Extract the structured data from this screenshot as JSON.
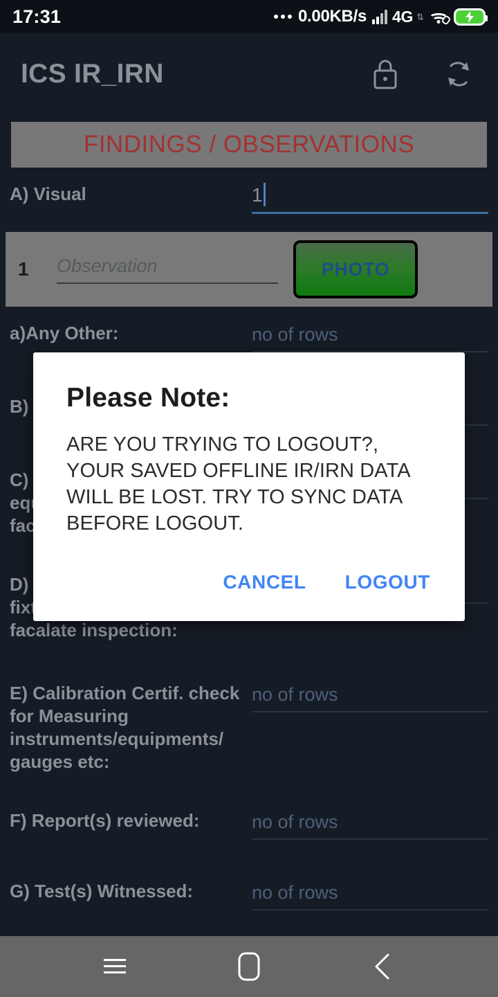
{
  "status_bar": {
    "time": "17:31",
    "net_speed": "0.00KB/s",
    "network_type": "4G",
    "icons": [
      "more-dots-icon",
      "signal-bars-icon",
      "wifi-icon",
      "battery-charging-icon"
    ]
  },
  "app_bar": {
    "title": "ICS IR_IRN",
    "lock_icon": "lock-icon",
    "sync_icon": "sync-icon"
  },
  "page": {
    "banner": "FINDINGS / OBSERVATIONS",
    "sections": [
      {
        "label": "A) Visual",
        "value": "1",
        "placeholder": "no of rows",
        "focused": true
      },
      {
        "label": "a)Any Other:",
        "value": "",
        "placeholder": "no of rows",
        "focused": false
      },
      {
        "label": "B)",
        "value": "",
        "placeholder": "no of rows",
        "focused": false
      },
      {
        "label": "C)\nequ\nfac",
        "value": "",
        "placeholder": "no of rows",
        "focused": false
      },
      {
        "label": "D)\nfixture/clamp used to\nfacalate inspection:",
        "value": "",
        "placeholder": "no of rows",
        "focused": false
      },
      {
        "label": "E) Calibration Certif. check for Measuring instruments/equipments/ gauges etc:",
        "value": "",
        "placeholder": "no of rows",
        "focused": false
      },
      {
        "label": "F) Report(s) reviewed:",
        "value": "",
        "placeholder": "no of rows",
        "focused": false
      },
      {
        "label": "G) Test(s) Witnessed:",
        "value": "",
        "placeholder": "no of rows",
        "focused": false
      }
    ],
    "observation_row": {
      "index": "1",
      "placeholder": "Observation",
      "photo_label": "PHOTO"
    }
  },
  "dialog": {
    "title": "Please Note:",
    "message": "ARE YOU TRYING TO LOGOUT?, YOUR SAVED OFFLINE IR/IRN DATA WILL BE LOST. TRY TO SYNC DATA BEFORE LOGOUT.",
    "cancel_label": "CANCEL",
    "confirm_label": "LOGOUT"
  },
  "nav_bar": {
    "recents_icon": "menu-icon",
    "home_icon": "home-square-icon",
    "back_icon": "chevron-left-icon"
  },
  "colors": {
    "background": "#161c25",
    "banner_bg": "#787878",
    "banner_text": "#a33232",
    "label_text": "#8b9099",
    "placeholder_text": "#4d6079",
    "accent_blue": "#4285f4",
    "photo_green": "#0f7a10",
    "battery_green": "#4cd137"
  }
}
